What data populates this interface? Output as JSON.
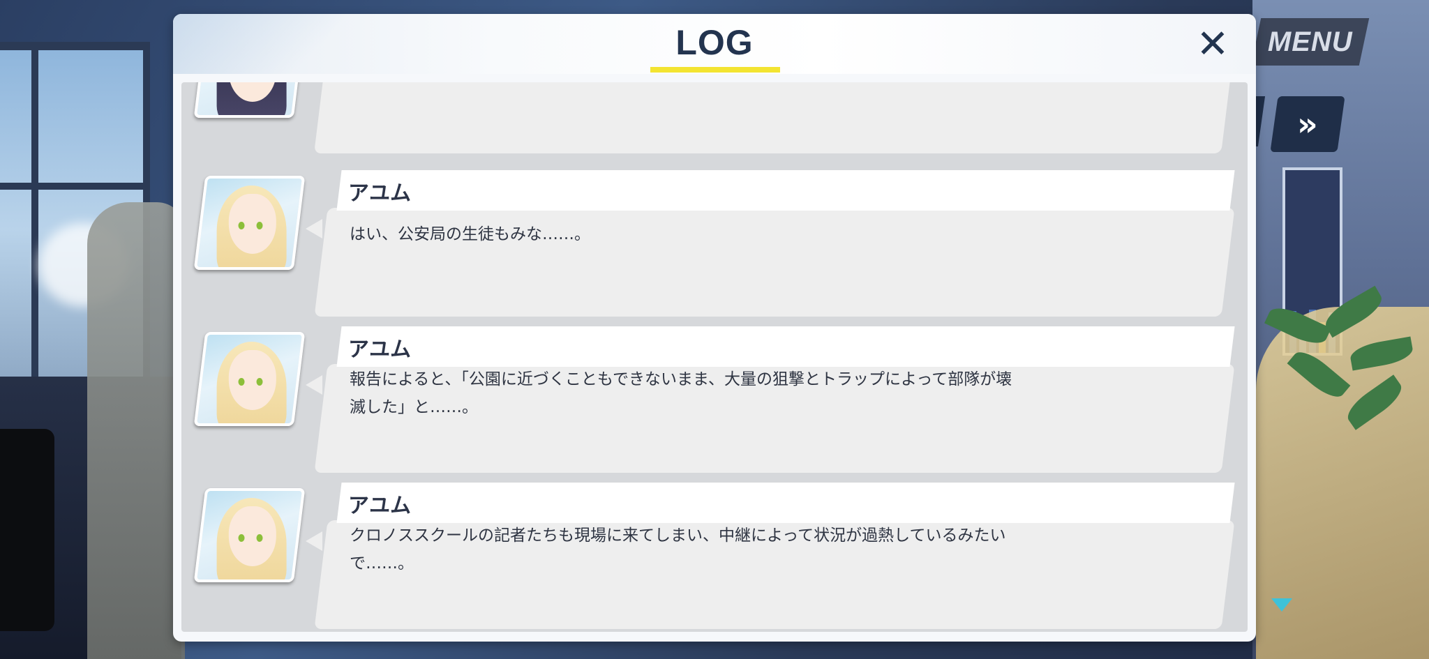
{
  "hud": {
    "menu_label": "MENU",
    "fast_forward_label": "»"
  },
  "log": {
    "title": "LOG",
    "close_label": "✕",
    "entries": [
      {
        "speaker": "",
        "text": ""
      },
      {
        "speaker": "アユム",
        "text": "はい、公安局の生徒もみな……。"
      },
      {
        "speaker": "アユム",
        "text": "報告によると、「公園に近づくこともできないまま、大量の狙撃とトラップによって部隊が壊\n滅した」と……。"
      },
      {
        "speaker": "アユム",
        "text": "クロノススクールの記者たちも現場に来てしまい、中継によって状況が過熱しているみたい\nで……。"
      }
    ]
  },
  "colors": {
    "title_underline": "#f3e431",
    "title_text": "#23344f",
    "scroll_arrow": "#3ec2d9"
  }
}
